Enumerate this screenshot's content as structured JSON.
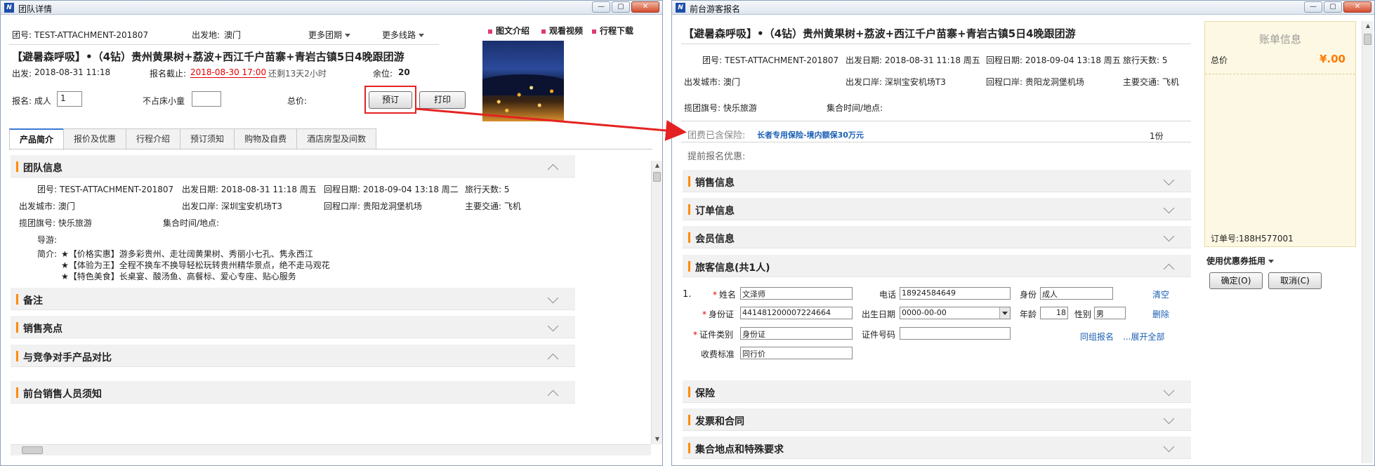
{
  "left_window": {
    "title": "团队详情",
    "header_row": {
      "team_no": "团号: TEST-ATTACHMENT-201807",
      "departure": "出发地:",
      "departure_value": "澳门",
      "more_groups": "更多团期",
      "more_routes": "更多线路"
    },
    "links": {
      "intro": "图文介绍",
      "video": "观看视频",
      "itinerary": "行程下载"
    },
    "product_title": "【避暑森呼吸】•（4钻）贵州黄果树+荔波+西江千户苗寨+青岩古镇5日4晚跟团游",
    "info_row": {
      "depart_label": "出发:",
      "depart_value": "2018-08-31 11:18",
      "deadline_label": "报名截止:",
      "deadline_value": "2018-08-30 17:00",
      "remaining": "还剩13天2小时",
      "seats_label": "余位:",
      "seats_value": "20"
    },
    "signup": {
      "label": "报名: 成人",
      "adult_count": "1",
      "child_label": "不占床小童",
      "child_count": "",
      "total_label": "总价:"
    },
    "buttons": {
      "book": "预订",
      "print": "打印"
    },
    "tabs": [
      "产品简介",
      "报价及优惠",
      "行程介绍",
      "预订须知",
      "购物及自费",
      "酒店房型及间数"
    ],
    "team_section": {
      "title": "团队信息",
      "team_no": "团号: TEST-ATTACHMENT-201807",
      "depart_date": "出发日期: 2018-08-31 11:18 周五",
      "return_date": "回程日期: 2018-09-04 13:18 周二",
      "days": "旅行天数: 5",
      "depart_city": "出发城市: 澳门",
      "depart_port": "出发口岸: 深圳宝安机场T3",
      "return_port": "回程口岸: 贵阳龙洞堡机场",
      "transport": "主要交通: 飞机",
      "flag": "揽团旗号: 快乐旅游",
      "gather": "集合时间/地点:",
      "guide": "导游:",
      "intro_label": "简介:",
      "intro_lines": [
        "★【价格实惠】游多彩贵州、走壮阔黄果树、秀丽小七孔、隽永西江",
        "★【体验为王】全程不换车不换导轻松玩转贵州精华景点，绝不走马观花",
        "★【特色美食】长桌宴、酸汤鱼、高餐标、爱心专座、贴心服务"
      ]
    },
    "sections": [
      "备注",
      "销售亮点",
      "与竞争对手产品对比",
      "前台销售人员须知"
    ]
  },
  "right_window": {
    "title": "前台游客报名",
    "product_title": "【避暑森呼吸】•（4钻）贵州黄果树+荔波+西江千户苗寨+青岩古镇5日4晚跟团游",
    "info": {
      "team_no": "团号: TEST-ATTACHMENT-201807",
      "depart_date": "出发日期: 2018-08-31 11:18 周五",
      "return_date": "回程日期: 2018-09-04 13:18 周五",
      "days": "旅行天数: 5",
      "depart_city": "出发城市: 澳门",
      "depart_port": "出发口岸: 深圳宝安机场T3",
      "return_port": "回程口岸: 贵阳龙洞堡机场",
      "transport": "主要交通: 飞机",
      "flag": "揽团旗号: 快乐旅游",
      "gather": "集合时间/地点:"
    },
    "insurance": {
      "label": "团费已含保险:",
      "value": "长者专用保险-境内额保30万元",
      "qty": "1份"
    },
    "early_discount": "提前报名优惠:",
    "sections_top": [
      "销售信息",
      "订单信息",
      "会员信息"
    ],
    "traveler_section": "旅客信息(共1人)",
    "traveler": {
      "index": "1.",
      "name_label": "姓名",
      "name_value": "文泽师",
      "phone_label": "电话",
      "phone_value": "18924584649",
      "identity_label": "身份",
      "identity_value": "成人",
      "clear": "清空",
      "id_label": "身份证",
      "id_value": "441481200007224664",
      "birth_label": "出生日期",
      "birth_value": "0000-00-00",
      "age_label": "年龄",
      "age_value": "18",
      "gender_label": "性别",
      "gender_value": "男",
      "delete": "删除",
      "doc_type_label": "证件类别",
      "doc_type_value": "身份证",
      "doc_no_label": "证件号码",
      "doc_no_value": "",
      "same_group": "同组报名",
      "expand": "...展开全部",
      "fee_label": "收费标准",
      "fee_value": "同行价"
    },
    "sections_bottom": [
      "保险",
      "发票和合同",
      "集合地点和特殊要求"
    ],
    "bill": {
      "title": "账单信息",
      "total_label": "总价",
      "total_value": "¥.00",
      "order_no": "订单号:188H577001"
    },
    "coupon": "使用优惠券抵用",
    "buttons": {
      "ok": "确定(O)",
      "cancel": "取消(C)"
    }
  },
  "colors": {
    "accent_red": "#e60000",
    "link_blue": "#1a5fb4",
    "section_bar": "#ff8a00",
    "bill_bg": "#fdf8e3"
  }
}
